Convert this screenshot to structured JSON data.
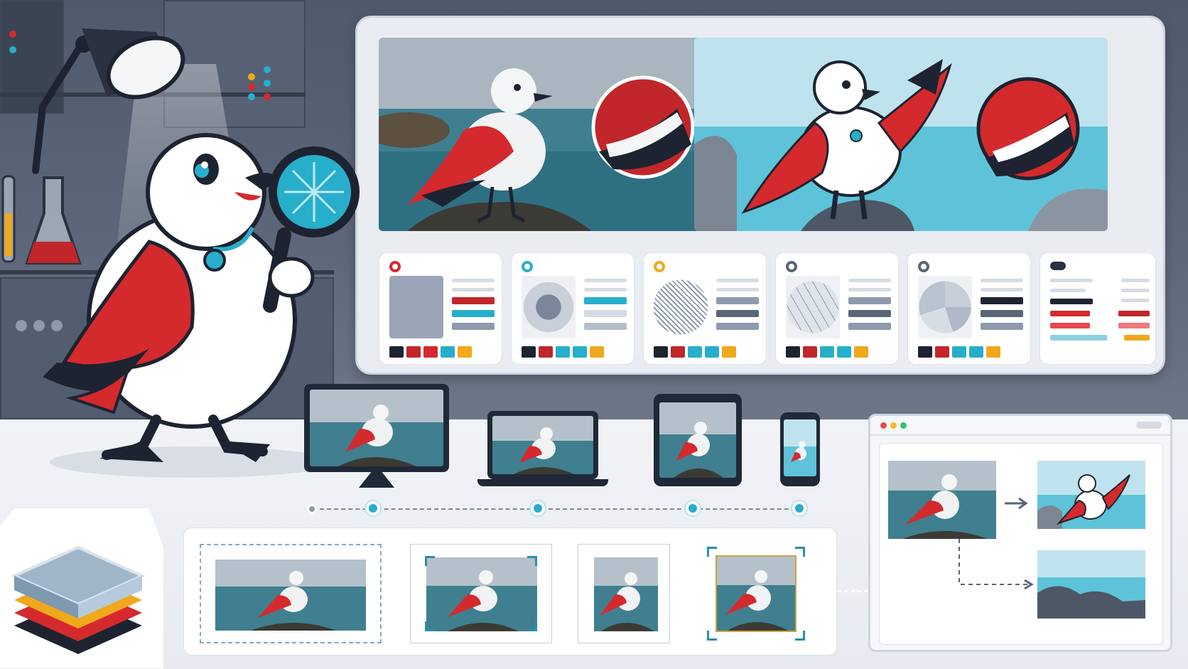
{
  "scene": {
    "colors": {
      "bird_red": "#d42a2e",
      "bird_black": "#1d2330",
      "accent_teal": "#27aecb",
      "accent_yellow": "#f0a81c",
      "sea_blue": "#5ec3d8",
      "sky_blue": "#bfe3ee"
    }
  },
  "board": {
    "photos": [
      {
        "style": "realistic",
        "icon": "seagull-photo"
      },
      {
        "style": "cartoon",
        "icon": "seagull-illustration"
      }
    ],
    "filter_cards": [
      {
        "indicator_color": "#d42a2e",
        "thumb": "pixel-grid-icon",
        "palette": [
          "#1d2330",
          "#c1262a",
          "#d42a2e",
          "#27aecb",
          "#f0a81c"
        ]
      },
      {
        "indicator_color": "#27aecb",
        "thumb": "pixelated-circle-icon",
        "palette": [
          "#1d2330",
          "#c1262a",
          "#27aecb",
          "#27aecb",
          "#f0a81c"
        ]
      },
      {
        "indicator_color": "#f0a81c",
        "thumb": "halftone-circle-icon",
        "palette": [
          "#1d2330",
          "#c1262a",
          "#27aecb",
          "#27aecb",
          "#f0a81c"
        ]
      },
      {
        "indicator_color": "#5a6577",
        "thumb": "triangle-mesh-icon",
        "palette": [
          "#1d2330",
          "#c1262a",
          "#27aecb",
          "#27aecb",
          "#f0a81c"
        ]
      },
      {
        "indicator_color": "#5a6577",
        "thumb": "lowpoly-circle-icon",
        "palette": [
          "#1d2330",
          "#c1262a",
          "#27aecb",
          "#27aecb",
          "#f0a81c"
        ]
      },
      {
        "indicator_color": "#1d2330",
        "thumb": "settings-list-icon",
        "palette": []
      }
    ]
  },
  "devices": [
    "desktop-monitor",
    "laptop",
    "tablet",
    "phone"
  ],
  "timeline_steps": 5,
  "crops": [
    "wide-crop",
    "framed-crop",
    "square-crop",
    "tight-crop"
  ],
  "browser": {
    "traffic_lights": [
      "#e5484d",
      "#f5b82e",
      "#2fbf71"
    ]
  }
}
